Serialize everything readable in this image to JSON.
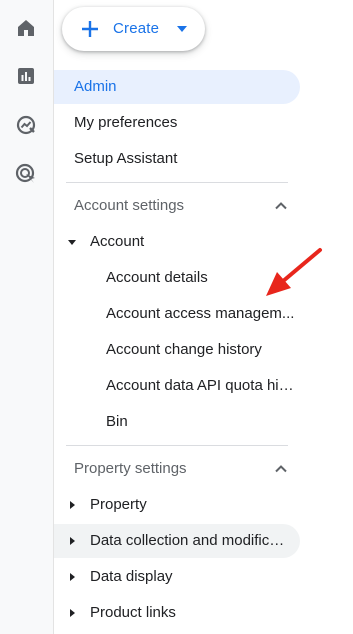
{
  "rail": {
    "items": [
      {
        "icon": "home-icon"
      },
      {
        "icon": "reports-icon"
      },
      {
        "icon": "explore-icon"
      },
      {
        "icon": "advertising-icon"
      }
    ]
  },
  "create_button": {
    "label": "Create",
    "accent": "#1a73e8"
  },
  "nav": {
    "top_items": [
      "Admin",
      "My preferences",
      "Setup Assistant"
    ],
    "selected": "Admin",
    "account_section": {
      "title": "Account settings",
      "group": "Account",
      "children": [
        "Account details",
        "Account access managem...",
        "Account change history",
        "Account data API quota his...",
        "Bin"
      ]
    },
    "property_section": {
      "title": "Property settings",
      "groups": [
        "Property",
        "Data collection and modifica...",
        "Data display",
        "Product links"
      ]
    }
  },
  "annotation": {
    "color": "#e8261c"
  },
  "colors": {
    "selected_bg": "#e8f0fe",
    "hover_bg": "#f1f3f4",
    "divider": "#dadce0"
  }
}
